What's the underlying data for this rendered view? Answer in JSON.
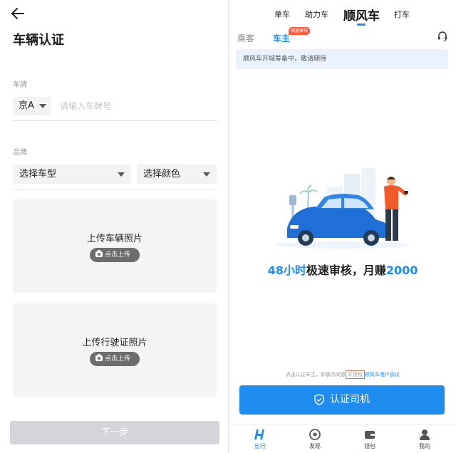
{
  "left": {
    "title": "车辆认证",
    "plate_label": "车牌",
    "plate_prefix": "京A",
    "plate_placeholder": "请输入车牌号",
    "brand_label": "品牌",
    "car_model_select": "选择车型",
    "color_select": "选择颜色",
    "vehicle_photo_title": "上传车辆照片",
    "vehicle_photo_button": "点击上传",
    "license_photo_title": "上传行驶证照片",
    "license_photo_button": "点击上传",
    "next_button": "下一步"
  },
  "right": {
    "top_tabs": [
      {
        "label": "单车"
      },
      {
        "label": "助力车"
      },
      {
        "label": "顺风车"
      },
      {
        "label": "打车"
      }
    ],
    "role_tabs": {
      "passenger": "乘客",
      "owner": "车主"
    },
    "role_badge": "极速审核",
    "notice": "顺风车开城筹备中，敬请期待",
    "promo": {
      "hours": "48小时",
      "text1": "极速审核，月赚",
      "amount": "2000"
    },
    "agreement": {
      "prefix": "点击认证车主，即表示同意",
      "boxed": "并授权",
      "link": "顺风车用户协议"
    },
    "cert_button": "认证司机",
    "bottom_nav": [
      {
        "label": "出行",
        "icon": "h-logo-icon"
      },
      {
        "label": "发现",
        "icon": "compass-icon"
      },
      {
        "label": "钱包",
        "icon": "wallet-icon"
      },
      {
        "label": "我的",
        "icon": "person-icon"
      }
    ],
    "colors": {
      "accent": "#1a8cff",
      "button": "#1f8cf2",
      "badge": "#ff5a3c",
      "notice_bg": "#eaf3fd"
    }
  }
}
